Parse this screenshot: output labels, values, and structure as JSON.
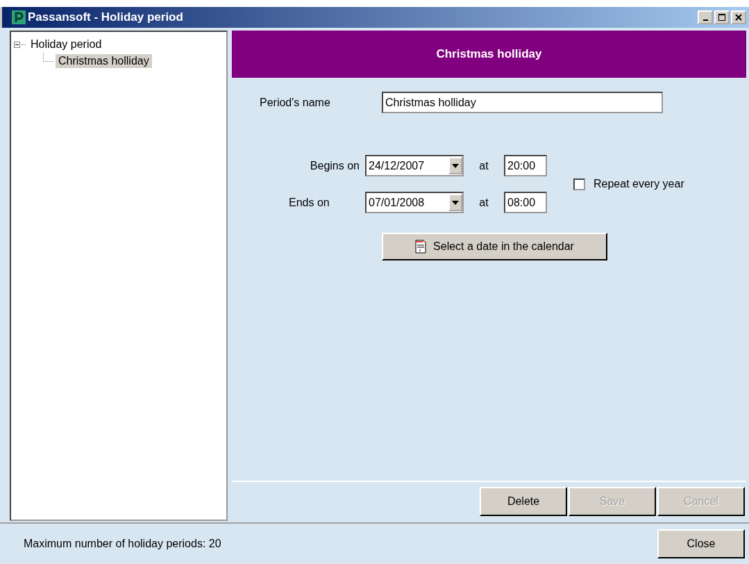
{
  "window": {
    "title": "Passansoft - Holiday period"
  },
  "tree": [
    {
      "label": "Holiday period",
      "expanded": true,
      "selected": false,
      "children": [
        {
          "label": "Christmas holliday",
          "selected": true
        }
      ]
    }
  ],
  "header": {
    "title": "Christmas holliday"
  },
  "form": {
    "name_label": "Period's name",
    "name_value": "Christmas holliday",
    "begins": {
      "label": "Begins on",
      "date": "24/12/2007",
      "at": "at",
      "time": "20:00"
    },
    "ends": {
      "label": "Ends on",
      "date": "07/01/2008",
      "at": "at",
      "time": "08:00"
    },
    "repeat": {
      "label": "Repeat every year",
      "checked": false
    },
    "calendar_button": "Select a date in the calendar"
  },
  "buttons": [
    {
      "label": "Delete",
      "disabled": false
    },
    {
      "label": "Save",
      "disabled": true
    },
    {
      "label": "Cancel",
      "disabled": true
    }
  ],
  "status_bar": {
    "text": "Maximum number of holiday periods: 20",
    "close": "Close"
  }
}
